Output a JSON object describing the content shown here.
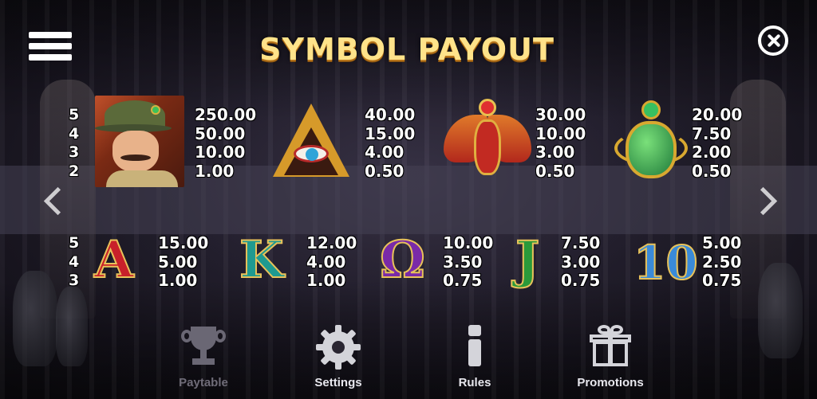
{
  "header": {
    "title": "SYMBOL PAYOUT"
  },
  "premium_symbols": [
    {
      "icon": "explorer-icon",
      "counts": [
        "5",
        "4",
        "3",
        "2"
      ],
      "pays": [
        "250.00",
        "50.00",
        "10.00",
        "1.00"
      ]
    },
    {
      "icon": "eye-of-horus-pyramid-icon",
      "pays": [
        "40.00",
        "15.00",
        "4.00",
        "0.50"
      ]
    },
    {
      "icon": "winged-falcon-icon",
      "pays": [
        "30.00",
        "10.00",
        "3.00",
        "0.50"
      ]
    },
    {
      "icon": "scarab-icon",
      "pays": [
        "20.00",
        "7.50",
        "2.00",
        "0.50"
      ]
    }
  ],
  "royal_symbols": [
    {
      "icon": "A-letter-icon",
      "letter": "A",
      "counts": [
        "5",
        "4",
        "3"
      ],
      "pays": [
        "15.00",
        "5.00",
        "1.00"
      ]
    },
    {
      "icon": "K-letter-icon",
      "letter": "K",
      "pays": [
        "12.00",
        "4.00",
        "1.00"
      ]
    },
    {
      "icon": "Q-letter-icon",
      "letter": "Ω",
      "pays": [
        "10.00",
        "3.50",
        "0.75"
      ]
    },
    {
      "icon": "J-letter-icon",
      "letter": "J",
      "pays": [
        "7.50",
        "3.00",
        "0.75"
      ]
    },
    {
      "icon": "10-letter-icon",
      "letter": "10",
      "pays": [
        "5.00",
        "2.50",
        "0.75"
      ]
    }
  ],
  "bottom_nav": [
    {
      "label": "Paytable",
      "icon": "trophy-icon",
      "active": false
    },
    {
      "label": "Settings",
      "icon": "gear-icon",
      "active": true
    },
    {
      "label": "Rules",
      "icon": "info-icon",
      "active": true
    },
    {
      "label": "Promotions",
      "icon": "gift-icon",
      "active": true
    }
  ],
  "colors": {
    "title": "#ffe38a",
    "title_shadow": "#b8751a",
    "nav_inactive": "#6f6c78"
  }
}
